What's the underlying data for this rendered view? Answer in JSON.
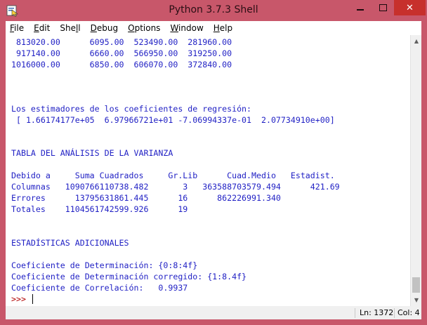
{
  "window": {
    "title": "Python 3.7.3 Shell",
    "minimize_glyph": "",
    "close_glyph": "✕"
  },
  "menu": [
    {
      "pre": "",
      "key": "F",
      "post": "ile"
    },
    {
      "pre": "",
      "key": "E",
      "post": "dit"
    },
    {
      "pre": "She",
      "key": "l",
      "post": "l"
    },
    {
      "pre": "",
      "key": "D",
      "post": "ebug"
    },
    {
      "pre": "",
      "key": "O",
      "post": "ptions"
    },
    {
      "pre": "",
      "key": "W",
      "post": "indow"
    },
    {
      "pre": "",
      "key": "H",
      "post": "elp"
    }
  ],
  "shell": {
    "lines": [
      " 813020.00      6095.00  523490.00  281960.00",
      " 917140.00      6660.00  566950.00  319250.00",
      "1016000.00      6850.00  606070.00  372840.00",
      "",
      "",
      "",
      "Los estimadores de los coeficientes de regresión:",
      " [ 1.66174177e+05  6.97966721e+01 -7.06994337e-01  2.07734910e+00]",
      "",
      "",
      "TABLA DEL ANÁLISIS DE LA VARIANZA",
      "",
      "Debido a     Suma Cuadrados     Gr.Lib      Cuad.Medio   Estadist.",
      "Columnas   1090766110738.482       3   363588703579.494      421.69",
      "Errores      13795631861.445      16      862226991.340",
      "Totales    1104561742599.926      19",
      "",
      "",
      "ESTADÍSTICAS ADICIONALES",
      "",
      "Coeficiente de Determinación: {0:8:4f}",
      "Coeficiente de Determinación corregido: {1:8.4f}",
      "Coeficiente de Correlación:   0.9937"
    ],
    "prompt": ">>> "
  },
  "status": {
    "line": "Ln: 1372",
    "col": "Col: 4"
  },
  "colors": {
    "output": "#1f1fc4",
    "prompt": "#b10000",
    "titlebar": "#c8576a"
  }
}
